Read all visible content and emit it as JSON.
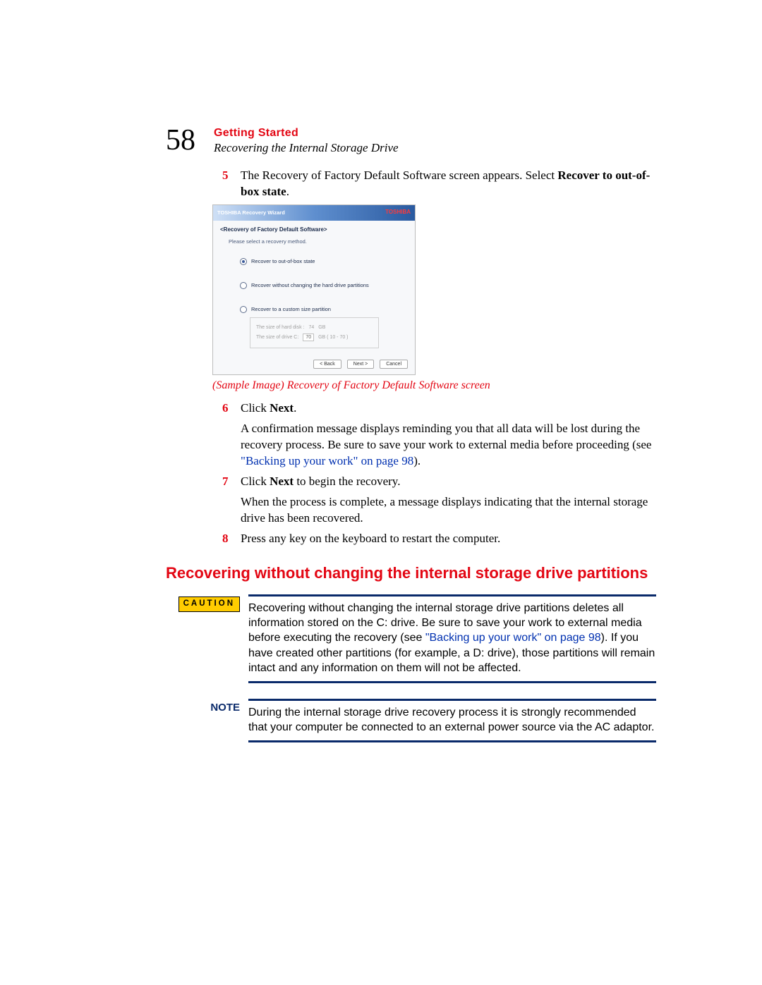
{
  "page_number": "58",
  "chapter_title": "Getting Started",
  "section_title": "Recovering the Internal Storage Drive",
  "step5": {
    "num": "5",
    "text_a": "The Recovery of Factory Default Software screen appears. Select ",
    "bold_a": "Recover to out-of-box state",
    "text_b": "."
  },
  "wizard": {
    "title": "TOSHIBA Recovery Wizard",
    "brand": "TOSHIBA",
    "heading": "<Recovery of Factory Default Software>",
    "subheading": "Please select a recovery method.",
    "opt1": "Recover to out-of-box state",
    "opt2": "Recover without changing the hard drive partitions",
    "opt3": "Recover to a custom size partition",
    "hd_line1_a": "The size of hard disk :",
    "hd_line1_b": "74",
    "hd_line1_c": "GB",
    "hd_line2_a": "The size of drive C:",
    "hd_line2_b": "70",
    "hd_line2_c": "GB ( 10 - 70 )",
    "btn_back": "< Back",
    "btn_next": "Next >",
    "btn_cancel": "Cancel"
  },
  "caption": "(Sample Image) Recovery of Factory Default Software screen",
  "step6": {
    "num": "6",
    "line1_a": "Click ",
    "line1_b": "Next",
    "line1_c": ".",
    "para_a": "A confirmation message displays reminding you that all data will be lost during the recovery process. Be sure to save your work to external media before proceeding (see ",
    "para_link": "\"Backing up your work\" on page 98",
    "para_b": ")."
  },
  "step7": {
    "num": "7",
    "line1_a": "Click ",
    "line1_b": "Next",
    "line1_c": " to begin the recovery.",
    "para": "When the process is complete, a message displays indicating that the internal storage drive has been recovered."
  },
  "step8": {
    "num": "8",
    "text": "Press any key on the keyboard to restart the computer."
  },
  "subsection_heading": "Recovering without changing the internal storage drive partitions",
  "caution_label": "CAUTION",
  "caution_a": "Recovering without changing the internal storage drive partitions deletes all information stored on the C: drive. Be sure to save your work to external media before executing the recovery (see ",
  "caution_link": "\"Backing up your work\" on page 98",
  "caution_b": "). If you have created other partitions (for example, a D: drive), those partitions will remain intact and any information on them will not be affected.",
  "note_label": "NOTE",
  "note_text": "During the internal storage drive recovery process it is strongly recommended that your computer be connected to an external power source via the AC adaptor."
}
